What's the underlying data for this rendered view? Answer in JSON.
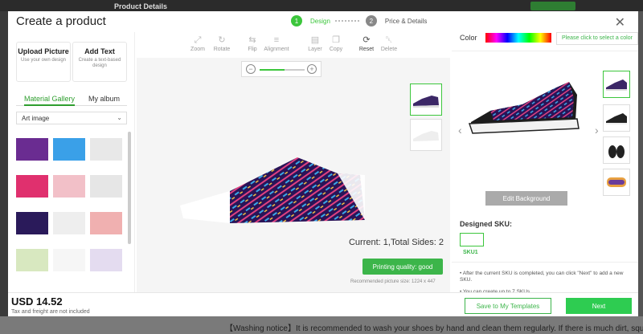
{
  "background": {
    "title": "Product Details",
    "notice": "【Washing notice】It is recommended to wash your shoes by hand and clean them regularly. If there is much dirt, squeeze"
  },
  "header": {
    "title": "Create a product",
    "steps": [
      {
        "num": "1",
        "label": "Design"
      },
      {
        "num": "2",
        "label": "Price & Details"
      }
    ]
  },
  "left": {
    "upload": {
      "title": "Upload Picture",
      "sub": "Use your own design"
    },
    "add_text": {
      "title": "Add Text",
      "sub": "Create a text-based design"
    },
    "tabs": [
      "Material Gallery",
      "My album"
    ],
    "select_value": "Art image",
    "thumbnails": [
      {
        "name": "purple-pattern",
        "color": "#6a2c91"
      },
      {
        "name": "blue-pattern",
        "color": "#3aa0e8"
      },
      {
        "name": "thank-god-text",
        "color": "#e8e8e8"
      },
      {
        "name": "pink-pattern",
        "color": "#e0306e"
      },
      {
        "name": "hearts-pattern",
        "color": "#f2c0c8"
      },
      {
        "name": "gray-texture",
        "color": "#e6e6e6"
      },
      {
        "name": "dark-stripes",
        "color": "#2a1a5a"
      },
      {
        "name": "2022-text",
        "color": "#eeeeee"
      },
      {
        "name": "red-check",
        "color": "#f0b0b0"
      },
      {
        "name": "pastel-lines",
        "color": "#d8e8c0"
      },
      {
        "name": "confetti",
        "color": "#f6f6f6"
      },
      {
        "name": "lilac-pattern",
        "color": "#e4dcf0"
      }
    ]
  },
  "toolbar": {
    "tools": [
      {
        "label": "Zoom",
        "icon": "⤢",
        "enabled": false
      },
      {
        "label": "Rotate",
        "icon": "↻",
        "enabled": false
      },
      {
        "label": "Flip",
        "icon": "⇆",
        "enabled": false
      },
      {
        "label": "Alignment",
        "icon": "≡",
        "enabled": false
      },
      {
        "label": "Layer",
        "icon": "▤",
        "enabled": false
      },
      {
        "label": "Copy",
        "icon": "❐",
        "enabled": false
      },
      {
        "label": "Reset",
        "icon": "⟳",
        "enabled": true
      },
      {
        "label": "Delete",
        "icon": "␡",
        "enabled": false
      }
    ],
    "zoom_level": 0.55
  },
  "canvas": {
    "count_text": "Current: 1,Total Sides: 2",
    "quality_label": "Printing quality: good",
    "recommended": "Recommended picture size: 1224 x 447"
  },
  "right": {
    "color_label": "Color",
    "color_hint": "Please click to select a color",
    "edit_bg": "Edit Background",
    "designed_sku": "Designed SKU:",
    "sku_name": "SKU1",
    "notes": [
      "After the current SKU is completed, you can click \"Next\" to add a new SKU.",
      "You can create up to 7 SKUs."
    ]
  },
  "footer": {
    "price": "USD 14.52",
    "tax": "Tax and freight are not included",
    "save_templates": "Save to My Templates",
    "next": "Next"
  }
}
